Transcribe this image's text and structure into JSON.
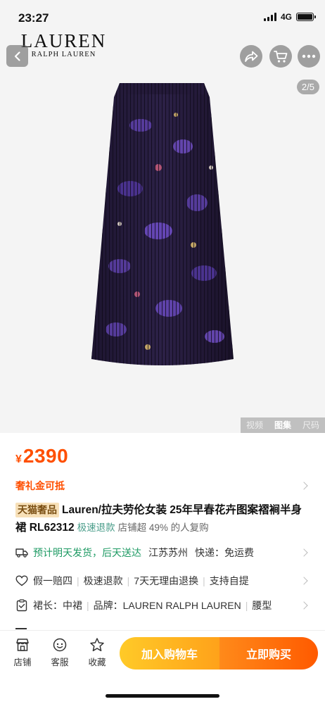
{
  "status_bar": {
    "time": "23:27",
    "network": "4G"
  },
  "brand": {
    "name": "LAUREN",
    "sub": "RALPH LAUREN"
  },
  "header": {
    "back_icon": "chevron-left-icon",
    "share_icon": "share-icon",
    "cart_icon": "cart-icon",
    "more_icon": "more-dots-icon"
  },
  "gallery": {
    "counter": "2/5",
    "tabs": [
      {
        "label": "视频",
        "active": false
      },
      {
        "label": "图集",
        "active": true
      },
      {
        "label": "尺码",
        "active": false
      }
    ]
  },
  "product": {
    "price_symbol": "¥",
    "price": "2390",
    "gift_text": "奢礼金可抵",
    "luxury_tag": "天猫奢品",
    "title": "Lauren/拉夫劳伦女装 25年早春花卉图案褶裥半身裙 RL62312",
    "refund_tag": "极速退款",
    "repurchase": "店铺超 49% 的人复购"
  },
  "shipping": {
    "icon": "truck-icon",
    "eta": "预计明天发货，后天送达",
    "location": "江苏苏州",
    "fee": "快递：免运费"
  },
  "guarantees": {
    "icon": "heart-icon",
    "items": [
      "假一赔四",
      "极速退款",
      "7天无理由退换",
      "支持自提"
    ]
  },
  "specs": {
    "icon": "clipboard-icon",
    "items": [
      "裙长：中裙",
      "品牌：LAUREN RALPH LAUREN",
      "腰型"
    ]
  },
  "bottom_nav": {
    "store": "店铺",
    "service": "客服",
    "favorite": "收藏",
    "add_to_cart": "加入购物车",
    "buy_now": "立即购买"
  },
  "colors": {
    "accent": "#ff4f00",
    "cart_button": "#ffb020",
    "buy_button": "#ff6a00",
    "skirt_base": "#2a1f3d",
    "skirt_purple": "#5a3fa0"
  }
}
